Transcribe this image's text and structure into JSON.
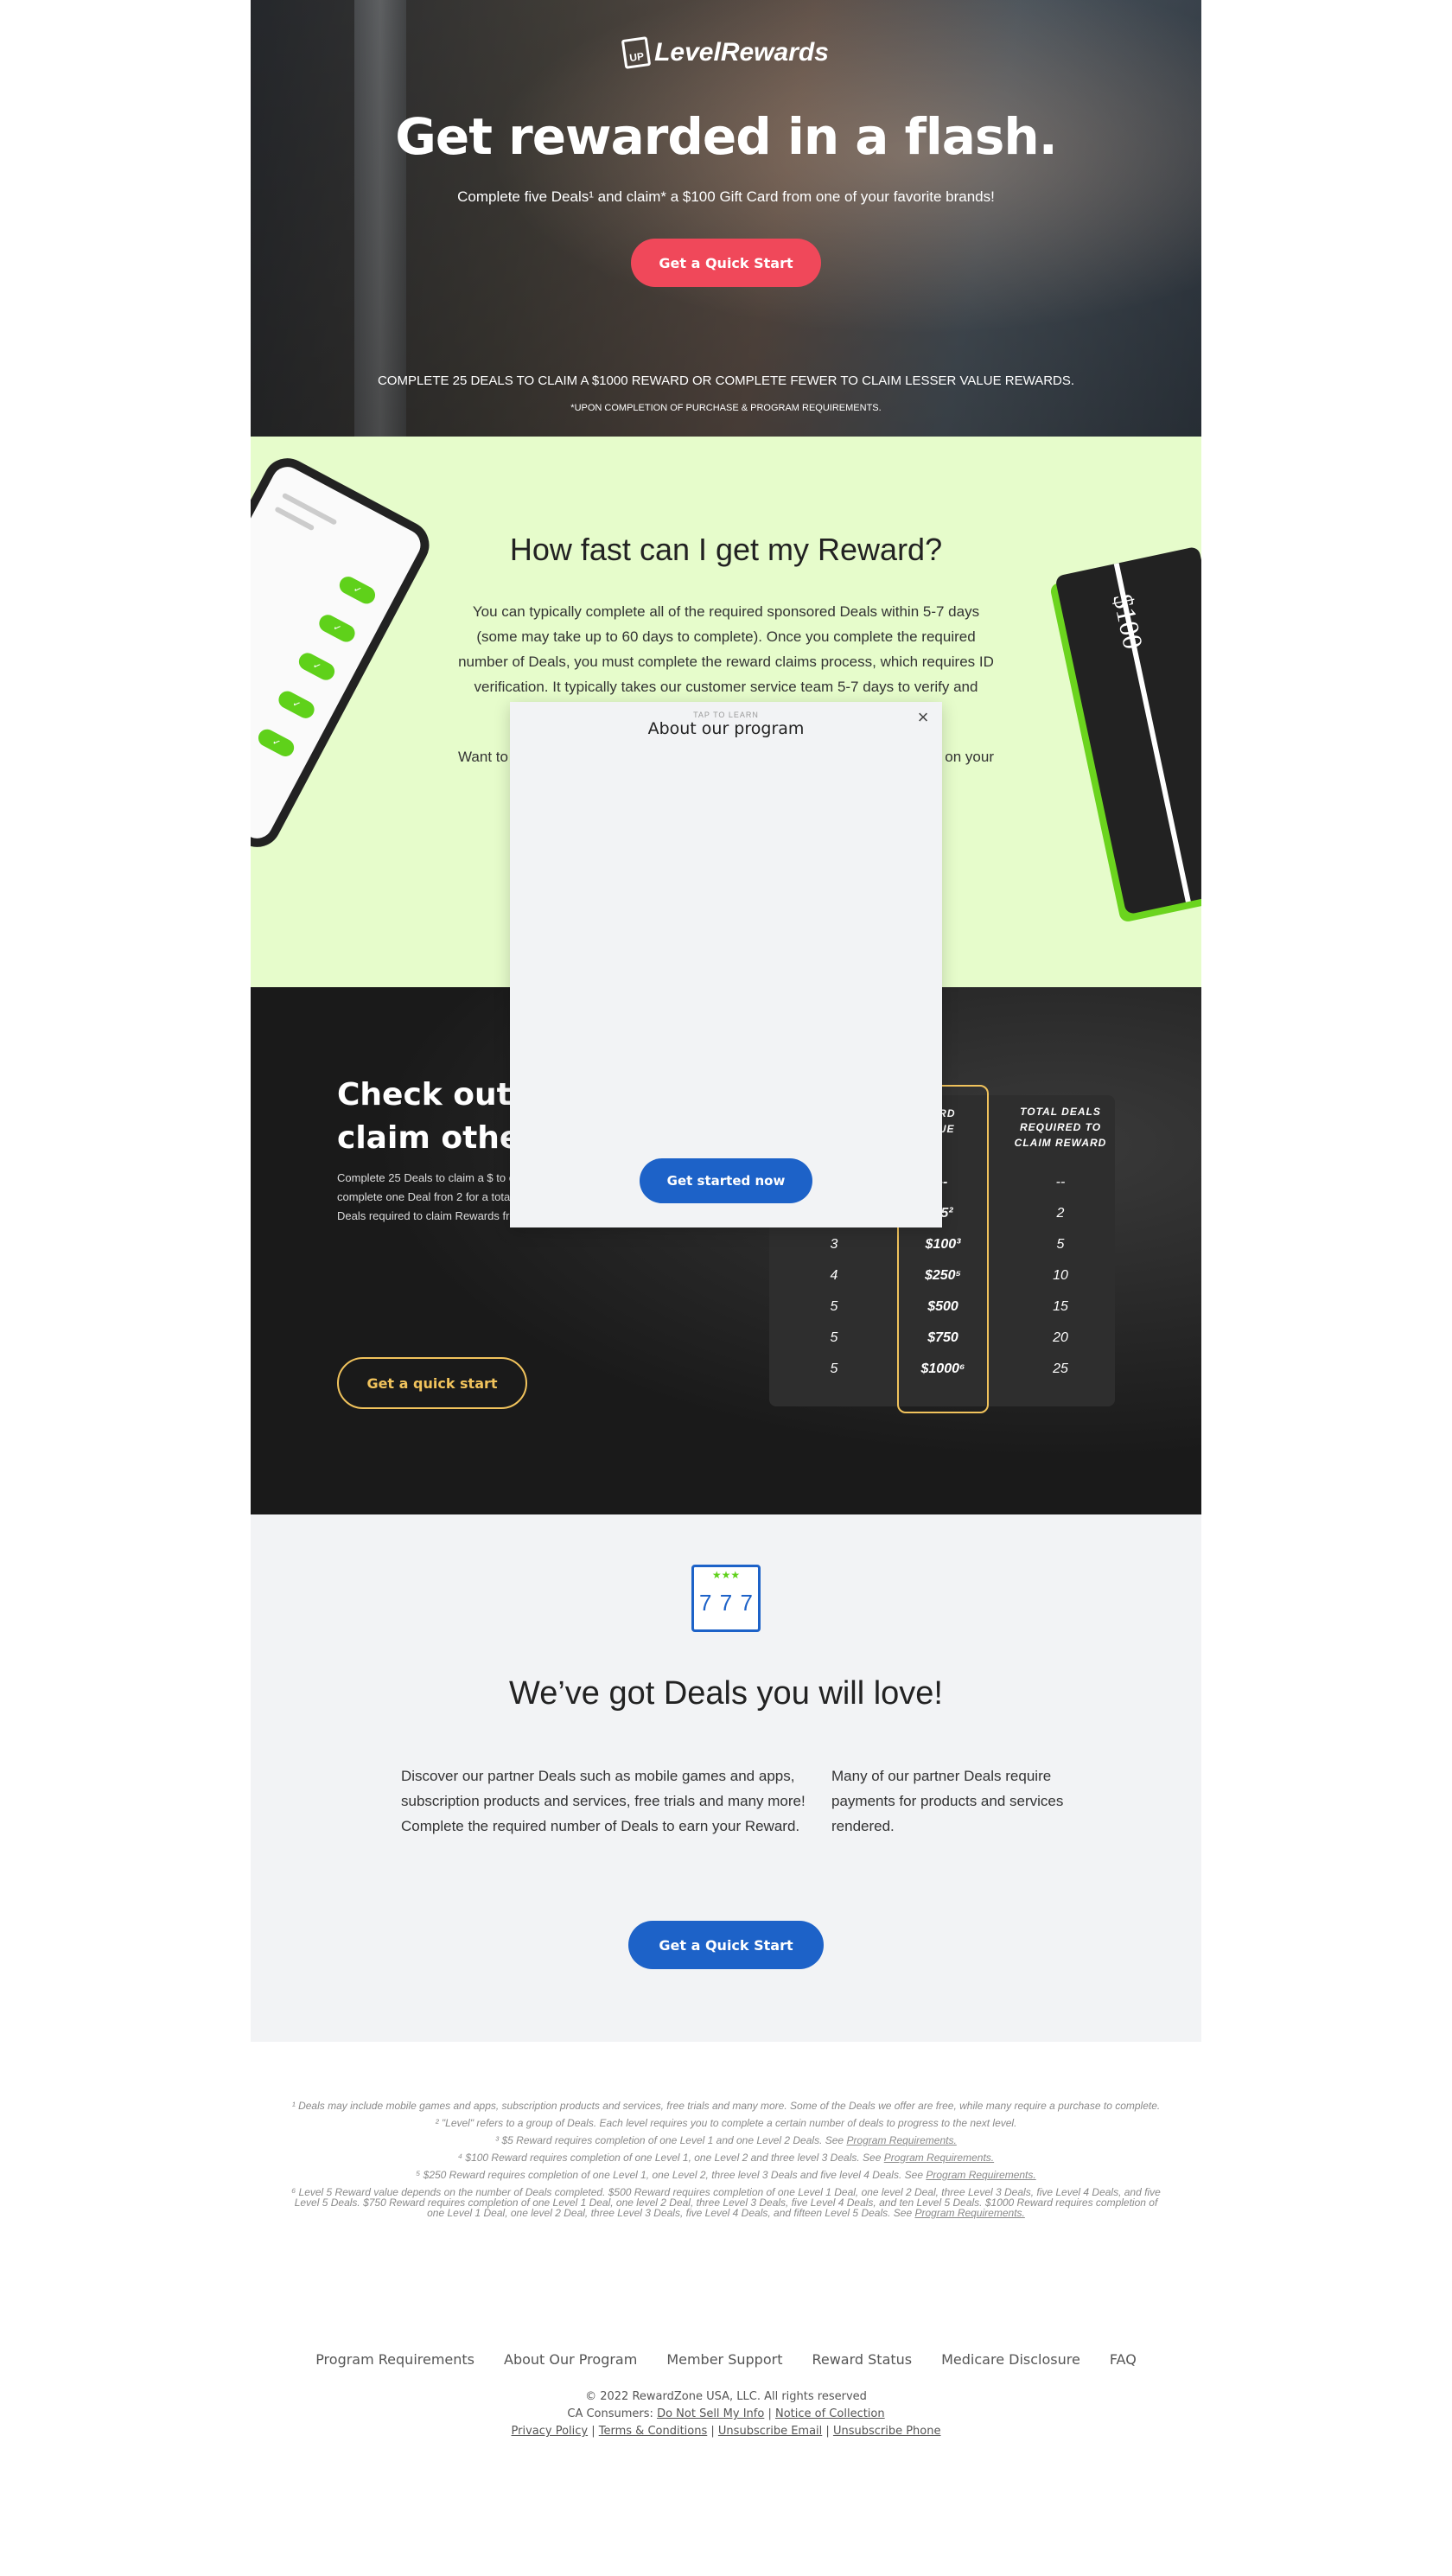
{
  "hero": {
    "logo_badge": "UP",
    "logo_text": "LevelRewards",
    "title": "Get rewarded in a flash.",
    "subtitle": "Complete five Deals¹ and claim* a $100 Gift Card from one of your favorite brands!",
    "cta": "Get a Quick Start",
    "note": "Complete 25 deals to claim a $1000 reward or complete fewer to claim lesser value rewards.",
    "note2_prefix": "*UPON COMPLETION OF",
    "note2_link": "PURCHASE & PROGRAM REQUIREMENTS."
  },
  "how_fast": {
    "title": "How fast can I get my Reward?",
    "para1": "You can typically complete all of the required sponsored Deals within 5-7 days (some may take up to 60 days to complete). Once you complete the required number of Deals, you must complete the reward claims process, which requires ID verification. It typically takes our customer service team 5-7 days to verify and",
    "para2": "Want to",
    "para2_end": "on your",
    "card_amount": "$100"
  },
  "levels": {
    "title": "Check out w claim othe",
    "title_line1": "Check out w",
    "title_line2": "claim othe",
    "text": "Complete 25 Deals to claim a $ to claim a lesser value Reward. Reward, complete one Deal fron 2 for a total of 2 Deals. See below for total # of Deals required to claim Rewards from each level.",
    "cta": "Get a quick start",
    "headers": [
      "",
      "REWARD VALUE",
      "TOTAL DEALS REQUIRED TO CLAIM REWARD"
    ],
    "header_value_visible": "ARD\nLUE",
    "rows": [
      {
        "level": "",
        "value": "--",
        "deals": "--"
      },
      {
        "level": "",
        "value": "$5²",
        "deals": "2"
      },
      {
        "level": "3",
        "value": "$100³",
        "deals": "5"
      },
      {
        "level": "4",
        "value": "$250⁵",
        "deals": "10"
      },
      {
        "level": "5",
        "value": "$500",
        "deals": "15"
      },
      {
        "level": "5",
        "value": "$750",
        "deals": "20"
      },
      {
        "level": "5",
        "value": "$1000⁶",
        "deals": "25"
      }
    ]
  },
  "deals": {
    "stars": "★★★",
    "sevens": [
      "7",
      "7",
      "7"
    ],
    "title": "We’ve got Deals you will love!",
    "left": "Discover our partner Deals such as mobile games and apps, subscription products and services, free trials and many more! Complete the required number of Deals to earn your Reward.",
    "right": "Many of our partner Deals require payments for products and services rendered.",
    "cta": "Get a Quick Start"
  },
  "footnotes": {
    "f1": "¹ Deals may include mobile games and apps, subscription products and services, free trials and many more. Some of the Deals we offer are free, while many require a purchase to complete.",
    "f2": "² \"Level\" refers to a group of Deals. Each level requires you to complete a certain number of deals to progress to the next level.",
    "f3": "³ $5 Reward requires completion of one Level 1 and one Level 2 Deals. See",
    "f4": "⁴ $100 Reward requires completion of one Level 1, one Level 2 and three level 3 Deals. See",
    "f5": "⁵ $250 Reward requires completion of one Level 1, one Level 2, three level 3 Deals and five level 4 Deals. See",
    "f6": "⁶ Level 5 Reward value depends on the number of Deals completed. $500 Reward requires completion of one Level 1 Deal, one level 2 Deal, three Level 3 Deals, five Level 4 Deals, and five Level 5 Deals. $750 Reward requires completion of one Level 1 Deal, one level 2 Deal, three Level 3 Deals, five Level 4 Deals, and ten Level 5 Deals. $1000 Reward requires completion of one Level 1 Deal, one level 2 Deal, three Level 3 Deals, five Level 4 Deals, and fifteen Level 5 Deals. See",
    "link": "Program Requirements."
  },
  "footer": {
    "links": [
      "Program Requirements",
      "About Our Program",
      "Member Support",
      "Reward Status",
      "Medicare Disclosure",
      "FAQ"
    ],
    "copyright": "© 2022 RewardZone USA, LLC. All rights reserved",
    "ca_label": "CA Consumers:",
    "do_not_sell": "Do Not Sell My Info",
    "notice": "Notice of Collection",
    "privacy": "Privacy Policy",
    "terms": "Terms & Conditions",
    "unsub_email": "Unsubscribe Email",
    "unsub_phone": "Unsubscribe Phone"
  },
  "modal": {
    "tap": "TAP TO LEARN",
    "title": "About our program",
    "close": "×",
    "cta": "Get started now"
  },
  "colors": {
    "brand_red": "#f0485a",
    "brand_blue": "#1d62c8",
    "accent_green": "#5fd11a",
    "gold": "#f1c35c"
  }
}
